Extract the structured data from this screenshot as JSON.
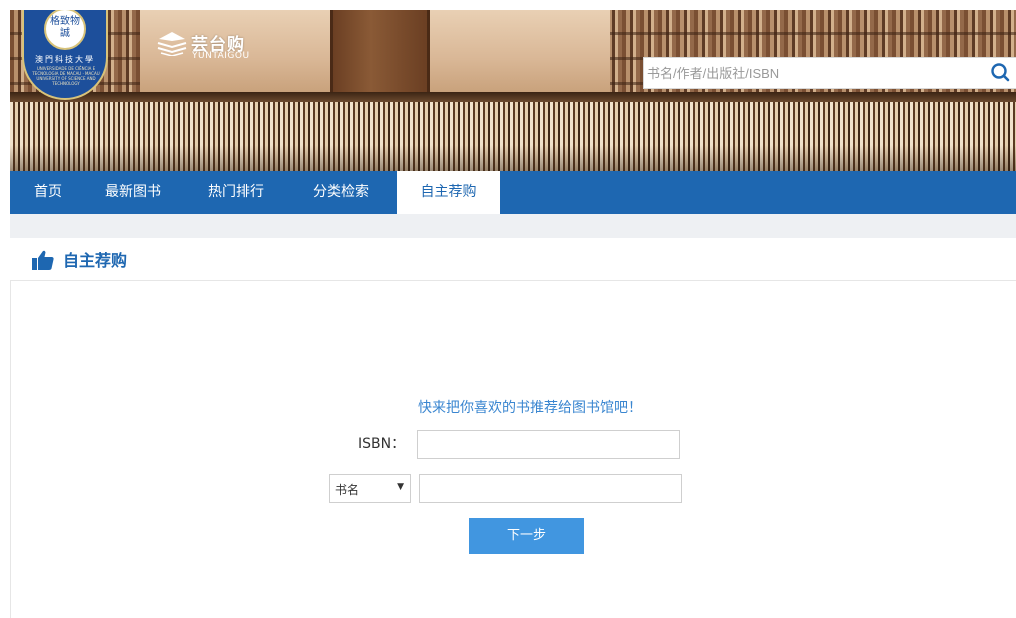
{
  "header": {
    "university_seal_text": "格致物誠",
    "university_name_cn": "澳門科技大學",
    "university_name_en": "UNIVERSIDADE DE CIÊNCIA E TECNOLOGIA DE MACAU · MACAU UNIVERSITY OF SCIENCE AND TECHNOLOGY",
    "brand_cn": "芸台购",
    "brand_en": "YUNTAIGOU",
    "search": {
      "placeholder": "书名/作者/出版社/ISBN",
      "value": "",
      "icon": "search-icon"
    }
  },
  "nav": {
    "items": [
      {
        "label": "首页",
        "active": false
      },
      {
        "label": "最新图书",
        "active": false
      },
      {
        "label": "热门排行",
        "active": false
      },
      {
        "label": "分类检索",
        "active": false
      },
      {
        "label": "自主荐购",
        "active": true
      }
    ]
  },
  "section": {
    "icon": "thumbs-up-icon",
    "title": "自主荐购"
  },
  "form": {
    "prompt": "快来把你喜欢的书推荐给图书馆吧！",
    "isbn_label": "ISBN：",
    "isbn_value": "",
    "field_select": {
      "selected": "书名",
      "arrow": "▼"
    },
    "field_value": "",
    "next_label": "下一步"
  },
  "colors": {
    "nav_bg": "#1e67b1",
    "accent": "#1e67b1",
    "prompt_text": "#3a86d0",
    "button_bg": "#4196e0"
  }
}
